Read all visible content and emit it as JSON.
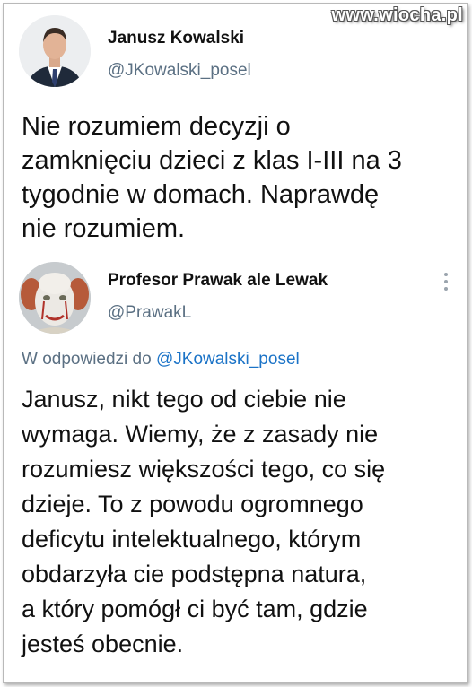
{
  "watermark": "www.wiocha.pl",
  "original_tweet": {
    "author_name": "Janusz Kowalski",
    "author_handle": "@JKowalski_posel",
    "text_lines": [
      "Nie rozumiem decyzji o",
      "zamknięciu dzieci z klas I-III na 3",
      "tygodnie w domach. Naprawdę",
      "nie rozumiem."
    ]
  },
  "reply_tweet": {
    "author_name": "Profesor Prawak ale Lewak",
    "author_handle": "@PrawakL",
    "reply_prefix": "W odpowiedzi do",
    "reply_mention": "@JKowalski_posel",
    "text_lines": [
      "Janusz, nikt tego od ciebie nie",
      "wymaga. Wiemy, że z zasady nie",
      "rozumiesz większości tego, co się",
      "dzieje. To z powodu ogromnego",
      "deficytu intelektualnego, którym",
      "obdarzyła cie podstępna natura,",
      "a który pomógł ci być tam, gdzie",
      "jesteś obecnie."
    ]
  },
  "icons": {
    "avatar_1": "person-photo-avatar",
    "avatar_2": "clown-photo-avatar",
    "more": "more-options-icon"
  },
  "colors": {
    "text": "#111111",
    "secondary": "#5b7083",
    "link": "#1b73c7"
  }
}
